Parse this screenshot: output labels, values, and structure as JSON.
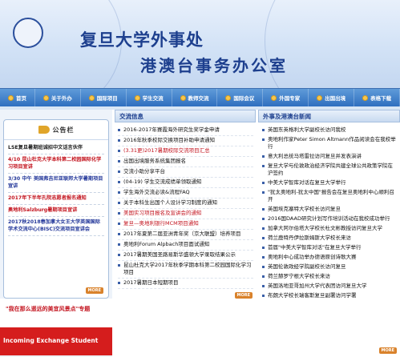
{
  "banner": {
    "title_line1": "复旦大学外事处",
    "title_line2": "港澳台事务办公室"
  },
  "nav": {
    "items": [
      {
        "label": "首页"
      },
      {
        "label": "关于外办"
      },
      {
        "label": "国际项目"
      },
      {
        "label": "学生交流"
      },
      {
        "label": "教师交流"
      },
      {
        "label": "国际会议"
      },
      {
        "label": "外国专家"
      },
      {
        "label": "出国出境"
      },
      {
        "label": "表格下载"
      }
    ]
  },
  "notice": {
    "title": "公告栏",
    "items": [
      {
        "text": "LSE复旦暑期班诚招中文话言伙伴",
        "style": "dark"
      },
      {
        "text": "4/10 昆山杜克大学本科第二校园国际化学习项目宣讲",
        "style": "red"
      },
      {
        "text": "3/30 中午 美国弗吉尼亚联邦大学暑期项目宣讲",
        "style": "blue"
      },
      {
        "text": "2017年下半年孔院志愿者报名通知",
        "style": "red"
      },
      {
        "text": "奥地利Salzburg暑期项目宣讲",
        "style": "red"
      },
      {
        "text": "2017秋2018春加拿大女王大学英国国际学术交流中心(BISC)交流项目宣讲会",
        "style": "blue"
      }
    ],
    "more_label": "MORE"
  },
  "left_footer": {
    "link_text": "\"我在那么遥远的美宜风景点\"专题",
    "exchange_label": "Incoming Exchange Student"
  },
  "exchange_news": {
    "title": "交流信息",
    "items": [
      {
        "text": "2016-2017年赛霞海外研究生奖学金申请",
        "style": "dark"
      },
      {
        "text": "2016年秋季校际交换项目补助申请通知",
        "style": "dark"
      },
      {
        "text": "(3.31更)2017暑期校际交流项目汇总",
        "style": "red"
      },
      {
        "text": "出国出境服务系统集团报名",
        "style": "dark"
      },
      {
        "text": "交流小助分享平台",
        "style": "dark"
      },
      {
        "text": "(04-19) 学生交流成绩单领取通知",
        "style": "dark"
      },
      {
        "text": "学生海外交流必读&流程FAQ",
        "style": "dark"
      },
      {
        "text": "关于本科生出国个人设计学习制度的通知",
        "style": "dark"
      },
      {
        "text": "美国实习项目报名及宣讲会的通知",
        "style": "red"
      },
      {
        "text": "复旦—奥地利银行MCM项目通知",
        "style": "red"
      },
      {
        "text": "2017年夏第二届亚洲青年奖（京大联盟）培养项目",
        "style": "dark"
      },
      {
        "text": "奥地利Forum Alpbach项目面试通知",
        "style": "dark"
      },
      {
        "text": "2017暑期美国圣路易斯华盛顿大学录取结果公示",
        "style": "dark"
      },
      {
        "text": "昆山杜克大学2017年秋季学期本科第二校园国际化学习项目",
        "style": "dark"
      },
      {
        "text": "2017暑期日本短期项目",
        "style": "dark"
      }
    ],
    "more_label": "MORE"
  },
  "foreign_news": {
    "title": "外事及港澳台新闻",
    "items": [
      {
        "text": "英国东英格利大学副校长访问我校"
      },
      {
        "text": "奥地利作家Peter Simon Altmann作品阅读会在我校举行"
      },
      {
        "text": "意大利总统马塔雷拉访问复旦并发表演讲"
      },
      {
        "text": "复旦大学与伦敦政治经济学院共建全球公共政策学院在沪签约"
      },
      {
        "text": "中美大学智库对话在复旦大学举行"
      },
      {
        "text": "\"犹太奥地利-犹太中国\"报告会在复旦奥地利中心顺利召开"
      },
      {
        "text": "英国埃克塞特大学校长访问复旦"
      },
      {
        "text": "2016国DAAD研究计划写作培训活动在我校成功举行"
      },
      {
        "text": "加拿大阿尔伯塔大学校长杜文彬教授访问复旦大学"
      },
      {
        "text": "荷兰鹿特丹伊拉斯姆斯大学校长来访"
      },
      {
        "text": "首届\"中美大学智库对话\"在复旦大学举行"
      },
      {
        "text": "奥地利中心成功举办德语原创诗歌大赛"
      },
      {
        "text": "英国伦敦政经学院副校长访问复旦"
      },
      {
        "text": "荷兰赫罗宁根大学校长来访"
      },
      {
        "text": "英国洛地亚哥加州大学代表团访问复旦大学"
      },
      {
        "text": "布朗大学校长瑞客斯复旦副署访问学署"
      }
    ],
    "more_label": "MORE"
  },
  "colors": {
    "nav_blue": "#2f6fbf",
    "title_blue": "#1d3f8e",
    "alert_red": "#c3141f",
    "exchange_red": "#d51d1d"
  }
}
